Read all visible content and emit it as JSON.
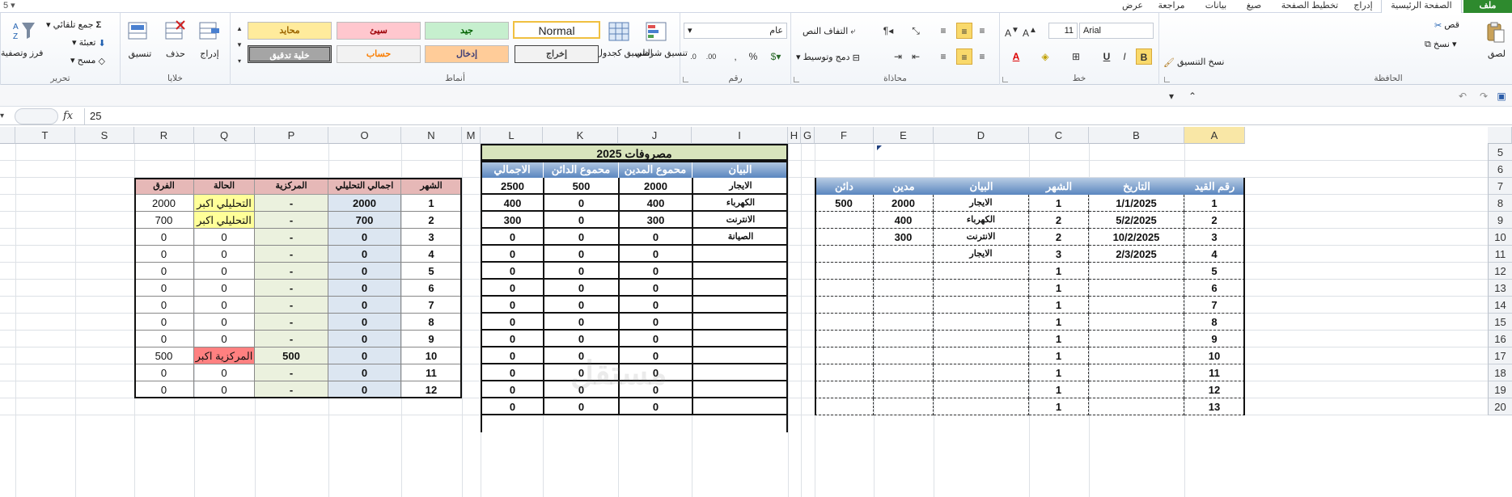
{
  "qat": "5 ▾",
  "tabs": [
    {
      "label": "ملف"
    },
    {
      "label": "الصفحة الرئيسية"
    },
    {
      "label": "إدراج"
    },
    {
      "label": "تخطيط الصفحة"
    },
    {
      "label": "صيغ"
    },
    {
      "label": "بيانات"
    },
    {
      "label": "مراجعة"
    },
    {
      "label": "عرض"
    }
  ],
  "ribbon": {
    "clipboard": {
      "label": "الحافظة",
      "paste": "لصق",
      "cut": "قص",
      "copy": "نسخ",
      "format_painter": "نسخ التنسيق"
    },
    "font": {
      "label": "خط",
      "name": "Arial",
      "size": "11",
      "bold": "B",
      "italic": "I",
      "underline": "U"
    },
    "alignment": {
      "label": "محاذاة",
      "wrap": "التفاف النص",
      "merge": "دمج وتوسيط"
    },
    "number": {
      "label": "رقم",
      "format": "عام"
    },
    "styles": {
      "label": "أنماط",
      "conditional": "تنسيق شرطي",
      "as_table": "التنسيق كجدول",
      "cells": [
        {
          "text": "Normal"
        },
        {
          "text": "جيد"
        },
        {
          "text": "سيئ"
        },
        {
          "text": "محايد"
        },
        {
          "text": "إخراج"
        },
        {
          "text": "إدخال"
        },
        {
          "text": "حساب"
        },
        {
          "text": "خلية تدقيق"
        }
      ],
      "colors": {
        "good": "#c6efce",
        "bad": "#ffc7ce",
        "neutral": "#ffeb9c",
        "input": "#ffcc99",
        "calc": "#f2f2f2",
        "check": "#a5a5a5"
      }
    },
    "cells_group": {
      "label": "خلايا",
      "insert": "إدراج",
      "delete": "حذف",
      "format": "تنسيق"
    },
    "editing": {
      "label": "تحرير",
      "autosum": "جمع تلقائي",
      "fill": "تعبئة",
      "clear": "مسح",
      "sort": "فرز وتصفية"
    }
  },
  "formula": {
    "name_box": "",
    "fx": "fx",
    "value": "25"
  },
  "columns": [
    "A",
    "B",
    "C",
    "D",
    "E",
    "F",
    "G",
    "H",
    "I",
    "J",
    "K",
    "L",
    "M",
    "N",
    "O",
    "P",
    "Q",
    "R",
    "S",
    "T"
  ],
  "rows": [
    "5",
    "6",
    "7",
    "8",
    "9",
    "10",
    "11",
    "12",
    "13",
    "14",
    "15",
    "16",
    "17",
    "18",
    "19",
    "20"
  ],
  "ledger": {
    "headers": [
      "رقم القيد",
      "التاريخ",
      "الشهر",
      "البيان",
      "مدين",
      "دائن"
    ],
    "rows": [
      [
        "1",
        "1/1/2025",
        "1",
        "الايجار",
        "2000",
        "500"
      ],
      [
        "2",
        "5/2/2025",
        "2",
        "الكهرباء",
        "400",
        ""
      ],
      [
        "3",
        "10/2/2025",
        "2",
        "الانترنت",
        "300",
        ""
      ],
      [
        "4",
        "2/3/2025",
        "3",
        "الايجار",
        "",
        ""
      ],
      [
        "5",
        "",
        "1",
        "",
        "",
        ""
      ],
      [
        "6",
        "",
        "1",
        "",
        "",
        ""
      ],
      [
        "7",
        "",
        "1",
        "",
        "",
        ""
      ],
      [
        "8",
        "",
        "1",
        "",
        "",
        ""
      ],
      [
        "9",
        "",
        "1",
        "",
        "",
        ""
      ],
      [
        "10",
        "",
        "1",
        "",
        "",
        ""
      ],
      [
        "11",
        "",
        "1",
        "",
        "",
        ""
      ],
      [
        "12",
        "",
        "1",
        "",
        "",
        ""
      ],
      [
        "13",
        "",
        "1",
        "",
        "",
        ""
      ]
    ]
  },
  "expenses": {
    "title": "مصروفات 2025",
    "headers": [
      "البيان",
      "محموع المدين",
      "محموع الدائن",
      "الاجمالي"
    ],
    "rows": [
      [
        "الايجار",
        "2000",
        "500",
        "2500"
      ],
      [
        "الكهرباء",
        "400",
        "0",
        "400"
      ],
      [
        "الانترنت",
        "300",
        "0",
        "300"
      ],
      [
        "الصيانة",
        "0",
        "0",
        "0"
      ],
      [
        "",
        "0",
        "0",
        "0"
      ],
      [
        "",
        "0",
        "0",
        "0"
      ],
      [
        "",
        "0",
        "0",
        "0"
      ],
      [
        "",
        "0",
        "0",
        "0"
      ],
      [
        "",
        "0",
        "0",
        "0"
      ],
      [
        "",
        "0",
        "0",
        "0"
      ],
      [
        "",
        "0",
        "0",
        "0"
      ],
      [
        "",
        "0",
        "0",
        "0"
      ],
      [
        "",
        "0",
        "0",
        "0"
      ],
      [
        "",
        "0",
        "0",
        "0"
      ]
    ]
  },
  "monthly": {
    "headers": [
      "الشهر",
      "اجمالي التحليلي",
      "المركزية",
      "الحالة",
      "الفرق"
    ],
    "rows": [
      [
        "1",
        "2000",
        "-",
        "التحليلي اكبر",
        "2000"
      ],
      [
        "2",
        "700",
        "-",
        "التحليلي اكبر",
        "700"
      ],
      [
        "3",
        "0",
        "-",
        "0",
        "0"
      ],
      [
        "4",
        "0",
        "-",
        "0",
        "0"
      ],
      [
        "5",
        "0",
        "-",
        "0",
        "0"
      ],
      [
        "6",
        "0",
        "-",
        "0",
        "0"
      ],
      [
        "7",
        "0",
        "-",
        "0",
        "0"
      ],
      [
        "8",
        "0",
        "-",
        "0",
        "0"
      ],
      [
        "9",
        "0",
        "-",
        "0",
        "0"
      ],
      [
        "10",
        "0",
        "500",
        "المركزية اكبر",
        "500"
      ],
      [
        "11",
        "0",
        "-",
        "0",
        "0"
      ],
      [
        "12",
        "0",
        "-",
        "0",
        "0"
      ]
    ],
    "status_colors": {
      "analytical": "#ffff99",
      "central": "#ff8080"
    }
  },
  "watermark": "مستقل"
}
